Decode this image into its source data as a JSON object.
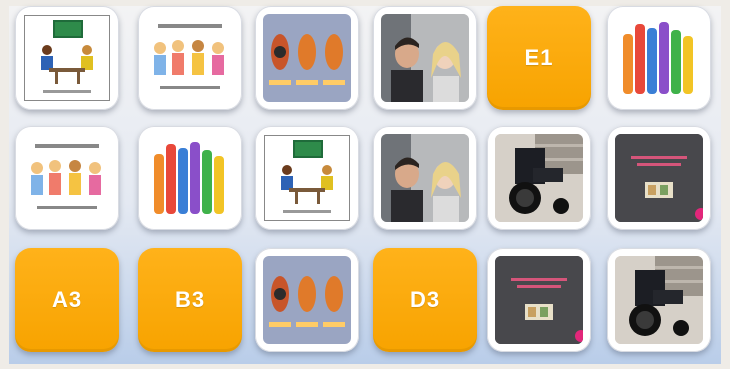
{
  "closed_cards": {
    "e1": "E1",
    "a3": "A3",
    "b3": "B3",
    "d3": "D3"
  },
  "card_images": {
    "classroom": "classroom-illustration",
    "children": "children-group-illustration",
    "senses": "ear-listening-panels",
    "couple": "couple-photo",
    "hands": "raised-colored-hands",
    "wheelchair": "wheelchair-photo",
    "slide": "presentation-slide"
  },
  "colors": {
    "card_back": "#f7a300",
    "card_face": "#ffffff",
    "board_bottom": "#b9cde9"
  }
}
